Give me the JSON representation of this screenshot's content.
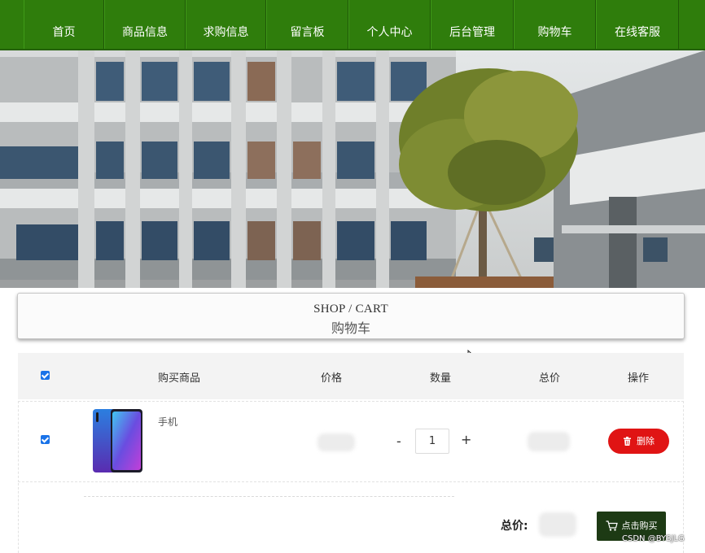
{
  "nav": {
    "items": [
      {
        "label": "首页"
      },
      {
        "label": "商品信息"
      },
      {
        "label": "求购信息"
      },
      {
        "label": "留言板"
      },
      {
        "label": "个人中心"
      },
      {
        "label": "后台管理"
      },
      {
        "label": "购物车"
      },
      {
        "label": "在线客服"
      }
    ]
  },
  "carousel": {
    "slide_count": 3,
    "active_index": 0
  },
  "section": {
    "title_en": "SHOP / CART",
    "title_cn": "购物车"
  },
  "cart": {
    "select_all_checked": true,
    "columns": [
      "购买商品",
      "价格",
      "数量",
      "总价",
      "操作"
    ],
    "items": [
      {
        "checked": true,
        "name": "手机",
        "quantity": "1",
        "minus_label": "-",
        "plus_label": "+",
        "delete_label": "删除"
      }
    ],
    "total_label": "总价:",
    "buy_label": "点击购买"
  },
  "watermark": "CSDN @BYSJLG",
  "colors": {
    "nav_bg": "#2f7d0c",
    "delete_button": "#e01414",
    "buy_button": "#1d3a14",
    "checkbox": "#1a73e8",
    "dot_active": "#54c31f"
  }
}
